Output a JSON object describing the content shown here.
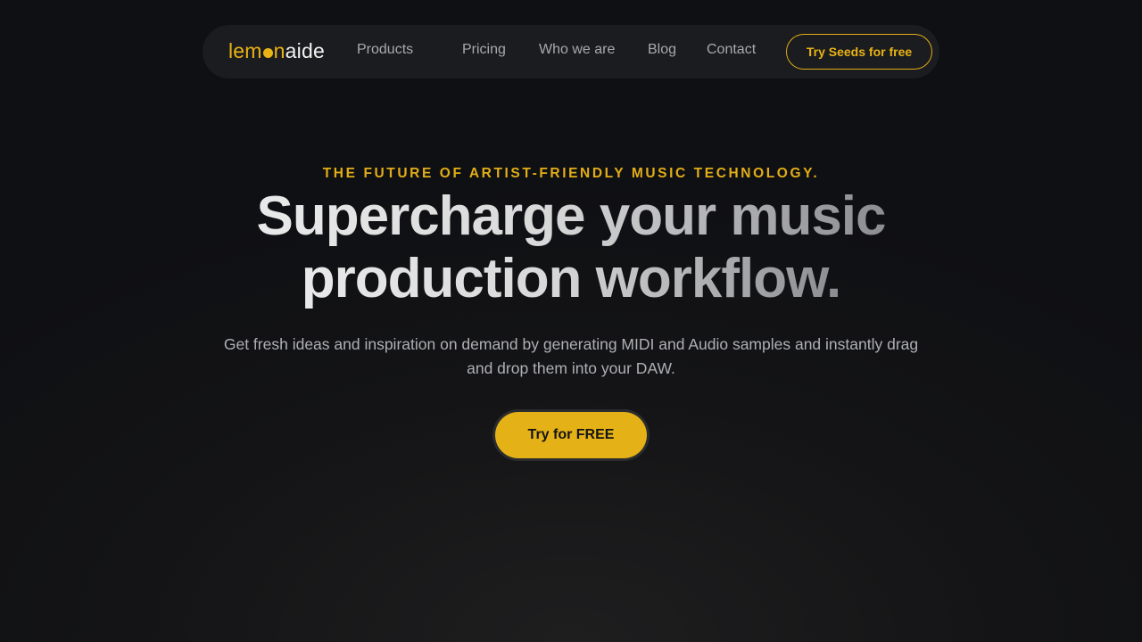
{
  "nav": {
    "logo": {
      "part1": "lem",
      "part2": "n",
      "part3": "aide"
    },
    "items": [
      {
        "label": "Products"
      },
      {
        "label": "Pricing"
      },
      {
        "label": "Who we are"
      },
      {
        "label": "Blog"
      },
      {
        "label": "Contact"
      }
    ],
    "cta_label": "Try Seeds for free"
  },
  "hero": {
    "eyebrow": "THE FUTURE OF ARTIST-FRIENDLY MUSIC TECHNOLOGY.",
    "headline_line1": "Supercharge your music",
    "headline_line2": "production workflow.",
    "subtitle": "Get fresh ideas and inspiration on demand by generating MIDI and Audio samples and instantly drag and drop them into your DAW.",
    "cta_label": "Try for FREE"
  },
  "colors": {
    "accent": "#e9b315",
    "background": "#111215",
    "nav_background": "#1b1c1f"
  }
}
